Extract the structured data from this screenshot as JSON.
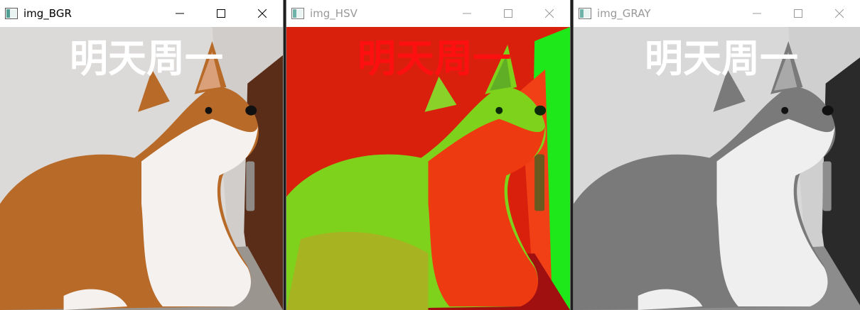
{
  "windows": [
    {
      "title": "img_BGR",
      "overlay_text": "明天周一",
      "active": true,
      "colors": {
        "bg": "#dcdad9",
        "fur": "#b86a28",
        "white": "#f4f1ee",
        "door": "#5a2d18",
        "floor": "#9a958e",
        "text": "#ffffff"
      }
    },
    {
      "title": "img_HSV",
      "overlay_text": "明天周一",
      "active": false,
      "colors": {
        "bg": "#d8200c",
        "fur": "#7fd21c",
        "white": "#ee3a10",
        "door": "#1fe81a",
        "floor": "#a01010",
        "text": "#ff1010"
      }
    },
    {
      "title": "img_GRAY",
      "overlay_text": "明天周一",
      "active": false,
      "colors": {
        "bg": "#d8d8d8",
        "fur": "#7a7a7a",
        "white": "#efefef",
        "door": "#2a2a2a",
        "floor": "#8c8c8c",
        "text": "#ffffff"
      }
    }
  ],
  "controls": {
    "minimize_icon": "minimize-icon",
    "maximize_icon": "maximize-icon",
    "close_icon": "close-icon"
  }
}
